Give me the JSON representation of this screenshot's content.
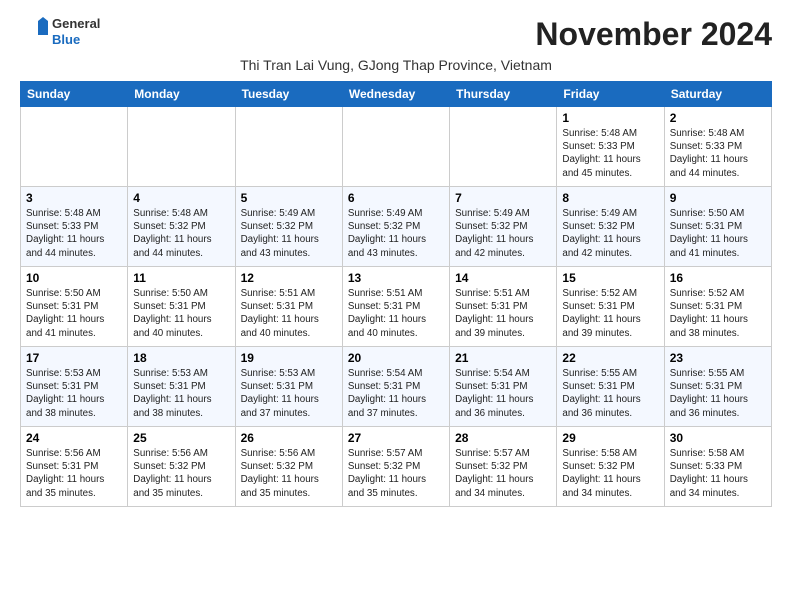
{
  "header": {
    "logo_general": "General",
    "logo_blue": "Blue",
    "month_title": "November 2024",
    "subtitle": "Thi Tran Lai Vung, GJong Thap Province, Vietnam"
  },
  "weekdays": [
    "Sunday",
    "Monday",
    "Tuesday",
    "Wednesday",
    "Thursday",
    "Friday",
    "Saturday"
  ],
  "weeks": [
    [
      {
        "day": "",
        "info": ""
      },
      {
        "day": "",
        "info": ""
      },
      {
        "day": "",
        "info": ""
      },
      {
        "day": "",
        "info": ""
      },
      {
        "day": "",
        "info": ""
      },
      {
        "day": "1",
        "info": "Sunrise: 5:48 AM\nSunset: 5:33 PM\nDaylight: 11 hours and 45 minutes."
      },
      {
        "day": "2",
        "info": "Sunrise: 5:48 AM\nSunset: 5:33 PM\nDaylight: 11 hours and 44 minutes."
      }
    ],
    [
      {
        "day": "3",
        "info": "Sunrise: 5:48 AM\nSunset: 5:33 PM\nDaylight: 11 hours and 44 minutes."
      },
      {
        "day": "4",
        "info": "Sunrise: 5:48 AM\nSunset: 5:32 PM\nDaylight: 11 hours and 44 minutes."
      },
      {
        "day": "5",
        "info": "Sunrise: 5:49 AM\nSunset: 5:32 PM\nDaylight: 11 hours and 43 minutes."
      },
      {
        "day": "6",
        "info": "Sunrise: 5:49 AM\nSunset: 5:32 PM\nDaylight: 11 hours and 43 minutes."
      },
      {
        "day": "7",
        "info": "Sunrise: 5:49 AM\nSunset: 5:32 PM\nDaylight: 11 hours and 42 minutes."
      },
      {
        "day": "8",
        "info": "Sunrise: 5:49 AM\nSunset: 5:32 PM\nDaylight: 11 hours and 42 minutes."
      },
      {
        "day": "9",
        "info": "Sunrise: 5:50 AM\nSunset: 5:31 PM\nDaylight: 11 hours and 41 minutes."
      }
    ],
    [
      {
        "day": "10",
        "info": "Sunrise: 5:50 AM\nSunset: 5:31 PM\nDaylight: 11 hours and 41 minutes."
      },
      {
        "day": "11",
        "info": "Sunrise: 5:50 AM\nSunset: 5:31 PM\nDaylight: 11 hours and 40 minutes."
      },
      {
        "day": "12",
        "info": "Sunrise: 5:51 AM\nSunset: 5:31 PM\nDaylight: 11 hours and 40 minutes."
      },
      {
        "day": "13",
        "info": "Sunrise: 5:51 AM\nSunset: 5:31 PM\nDaylight: 11 hours and 40 minutes."
      },
      {
        "day": "14",
        "info": "Sunrise: 5:51 AM\nSunset: 5:31 PM\nDaylight: 11 hours and 39 minutes."
      },
      {
        "day": "15",
        "info": "Sunrise: 5:52 AM\nSunset: 5:31 PM\nDaylight: 11 hours and 39 minutes."
      },
      {
        "day": "16",
        "info": "Sunrise: 5:52 AM\nSunset: 5:31 PM\nDaylight: 11 hours and 38 minutes."
      }
    ],
    [
      {
        "day": "17",
        "info": "Sunrise: 5:53 AM\nSunset: 5:31 PM\nDaylight: 11 hours and 38 minutes."
      },
      {
        "day": "18",
        "info": "Sunrise: 5:53 AM\nSunset: 5:31 PM\nDaylight: 11 hours and 38 minutes."
      },
      {
        "day": "19",
        "info": "Sunrise: 5:53 AM\nSunset: 5:31 PM\nDaylight: 11 hours and 37 minutes."
      },
      {
        "day": "20",
        "info": "Sunrise: 5:54 AM\nSunset: 5:31 PM\nDaylight: 11 hours and 37 minutes."
      },
      {
        "day": "21",
        "info": "Sunrise: 5:54 AM\nSunset: 5:31 PM\nDaylight: 11 hours and 36 minutes."
      },
      {
        "day": "22",
        "info": "Sunrise: 5:55 AM\nSunset: 5:31 PM\nDaylight: 11 hours and 36 minutes."
      },
      {
        "day": "23",
        "info": "Sunrise: 5:55 AM\nSunset: 5:31 PM\nDaylight: 11 hours and 36 minutes."
      }
    ],
    [
      {
        "day": "24",
        "info": "Sunrise: 5:56 AM\nSunset: 5:31 PM\nDaylight: 11 hours and 35 minutes."
      },
      {
        "day": "25",
        "info": "Sunrise: 5:56 AM\nSunset: 5:32 PM\nDaylight: 11 hours and 35 minutes."
      },
      {
        "day": "26",
        "info": "Sunrise: 5:56 AM\nSunset: 5:32 PM\nDaylight: 11 hours and 35 minutes."
      },
      {
        "day": "27",
        "info": "Sunrise: 5:57 AM\nSunset: 5:32 PM\nDaylight: 11 hours and 35 minutes."
      },
      {
        "day": "28",
        "info": "Sunrise: 5:57 AM\nSunset: 5:32 PM\nDaylight: 11 hours and 34 minutes."
      },
      {
        "day": "29",
        "info": "Sunrise: 5:58 AM\nSunset: 5:32 PM\nDaylight: 11 hours and 34 minutes."
      },
      {
        "day": "30",
        "info": "Sunrise: 5:58 AM\nSunset: 5:33 PM\nDaylight: 11 hours and 34 minutes."
      }
    ]
  ]
}
